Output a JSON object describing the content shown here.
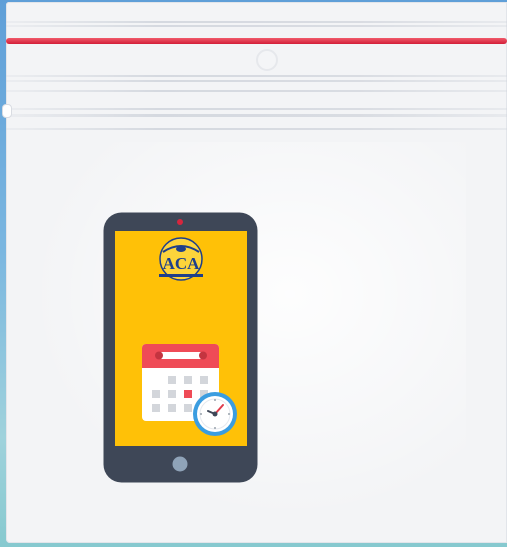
{
  "graphic": {
    "subject": "mobile-app-booking-illustration",
    "logo_text": "ACA",
    "logo_tagline": "",
    "icons": [
      "phone-icon",
      "calendar-icon",
      "clock-icon"
    ],
    "colors": {
      "background": "#6fa9dd",
      "bag": "#f3f4f6",
      "seal_stripe": "#e12440",
      "phone_body": "#3e4757",
      "phone_screen": "#ffc107",
      "calendar_header": "#ef4b57",
      "calendar_highlight": "#ef4b57",
      "clock_ring": "#3b9de0"
    }
  }
}
